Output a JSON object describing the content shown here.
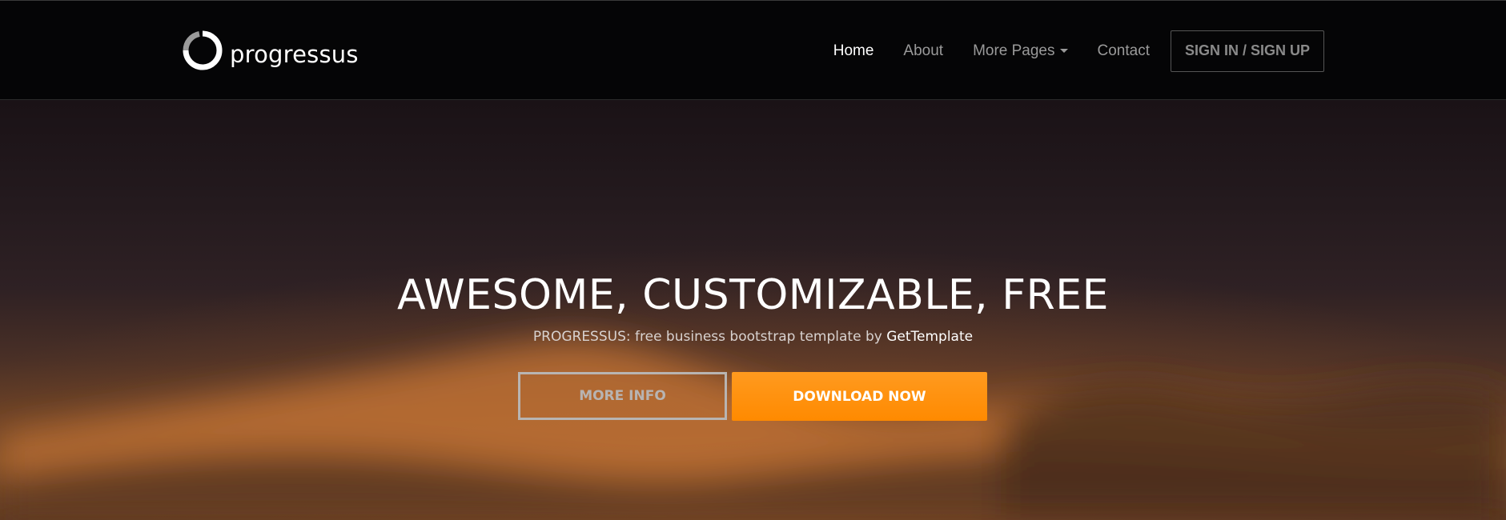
{
  "brand": {
    "name": "progressus",
    "logo_icon": "circle-arrows-logo-icon"
  },
  "nav": {
    "items": [
      {
        "label": "Home",
        "active": true
      },
      {
        "label": "About",
        "active": false
      },
      {
        "label": "More Pages",
        "active": false,
        "has_dropdown": true,
        "icon": "caret-down-icon"
      },
      {
        "label": "Contact",
        "active": false
      }
    ],
    "signin_label": "SIGN IN / SIGN UP"
  },
  "hero": {
    "title": "AWESOME, CUSTOMIZABLE, FREE",
    "subtitle_prefix": "PROGRESSUS: free business bootstrap template by ",
    "subtitle_link": "GetTemplate",
    "more_info_label": "MORE INFO",
    "download_label": "DOWNLOAD NOW"
  },
  "colors": {
    "navbar_bg": "#050506",
    "accent": "#ff8a00",
    "nav_active": "#ffffff",
    "nav_inactive": "#9a9a9a"
  }
}
